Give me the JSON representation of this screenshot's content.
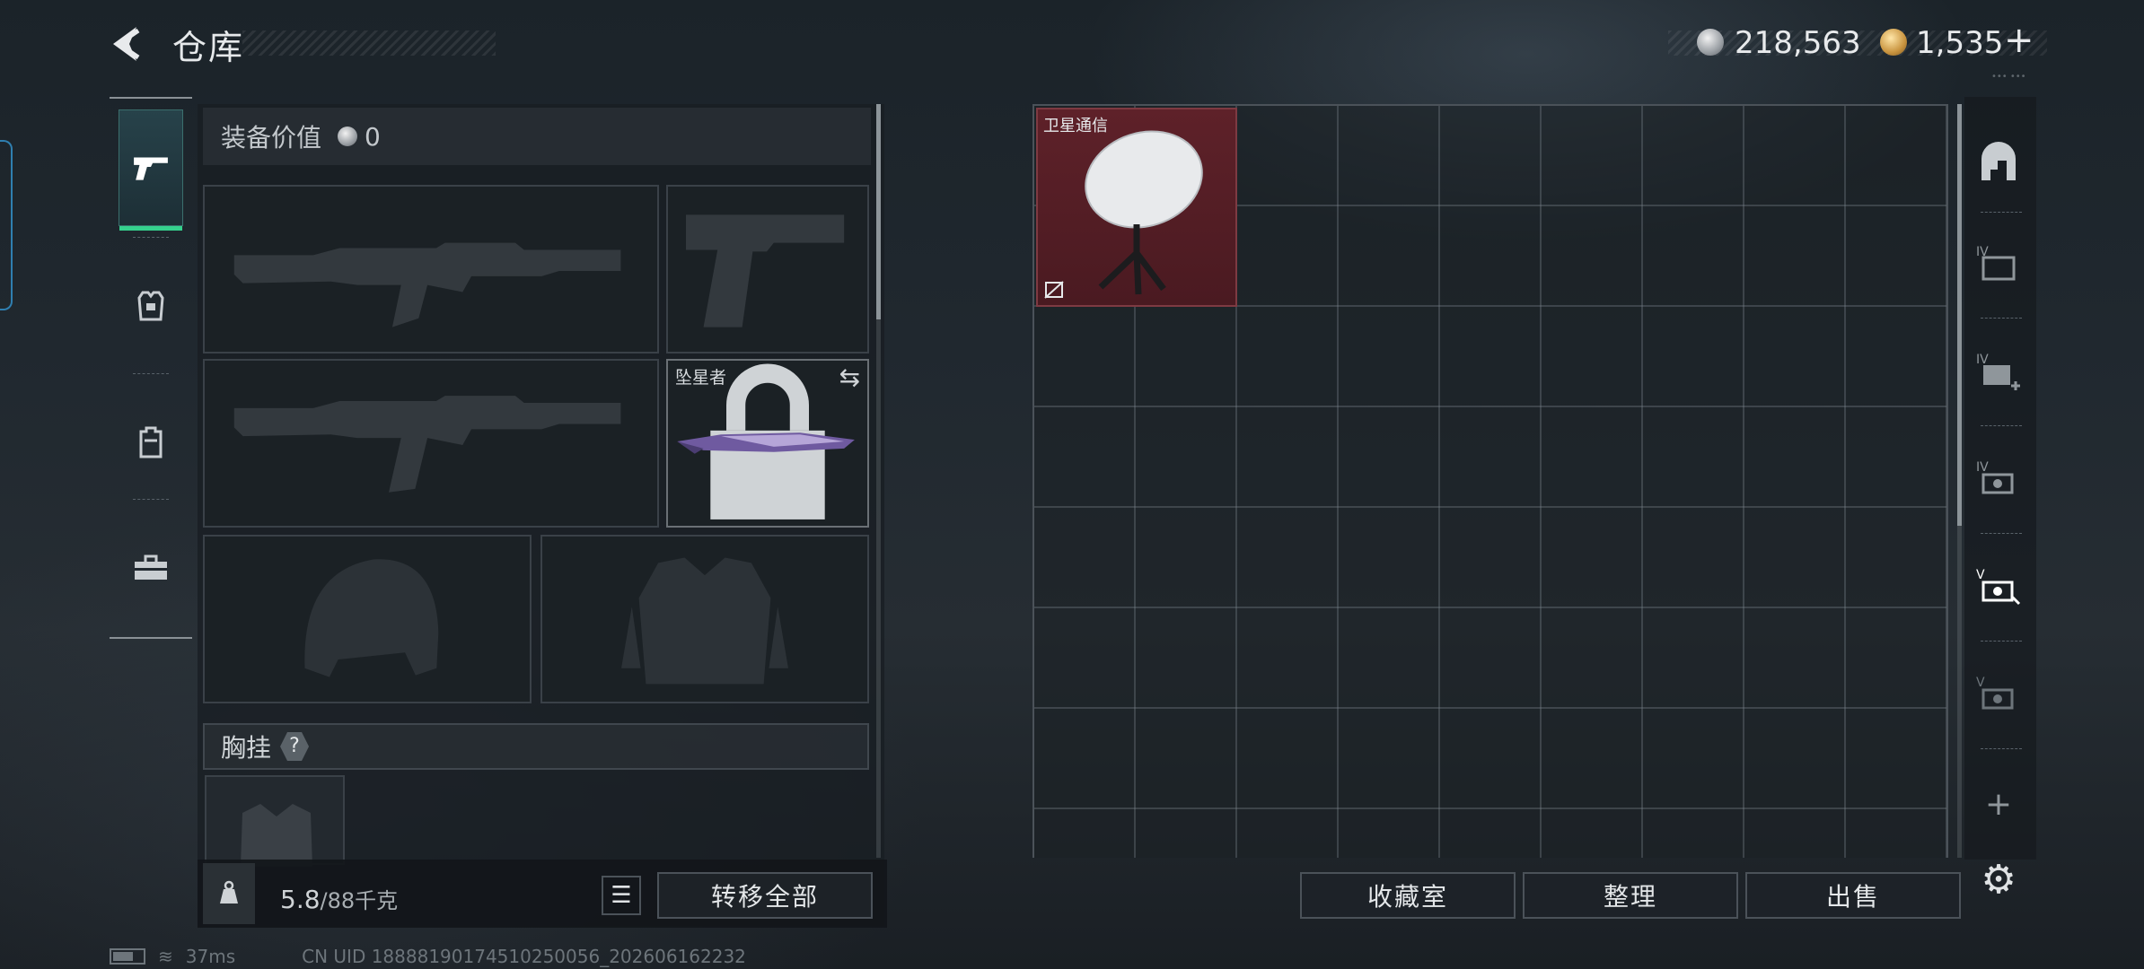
{
  "header": {
    "title": "仓库",
    "currency_silver": "218,563",
    "currency_gold": "1,535",
    "currency_add": "+"
  },
  "left_tabs": [
    "weapons-tab",
    "armor-tab",
    "backpack-tab",
    "toolbox-tab"
  ],
  "loadout": {
    "equip_value_label": "装备价值",
    "equip_value": "0",
    "knife_name": "坠星者",
    "chest_rig_label": "胸挂",
    "chest_rig_help": "?"
  },
  "footer_left": {
    "weight_current": "5.8",
    "weight_max": "/88",
    "weight_unit": "千克",
    "transfer_all": "转移全部"
  },
  "stash": {
    "item_name": "卫星通信"
  },
  "footer_right": {
    "collection_room": "收藏室",
    "organize": "整理",
    "sell": "出售",
    "add": "+"
  },
  "status": {
    "ping": "37ms",
    "uid": "CN UID 18888190174510250056_202606162232"
  },
  "colors": {
    "accent_green": "#35d18d",
    "item_red": "#5e2129"
  }
}
